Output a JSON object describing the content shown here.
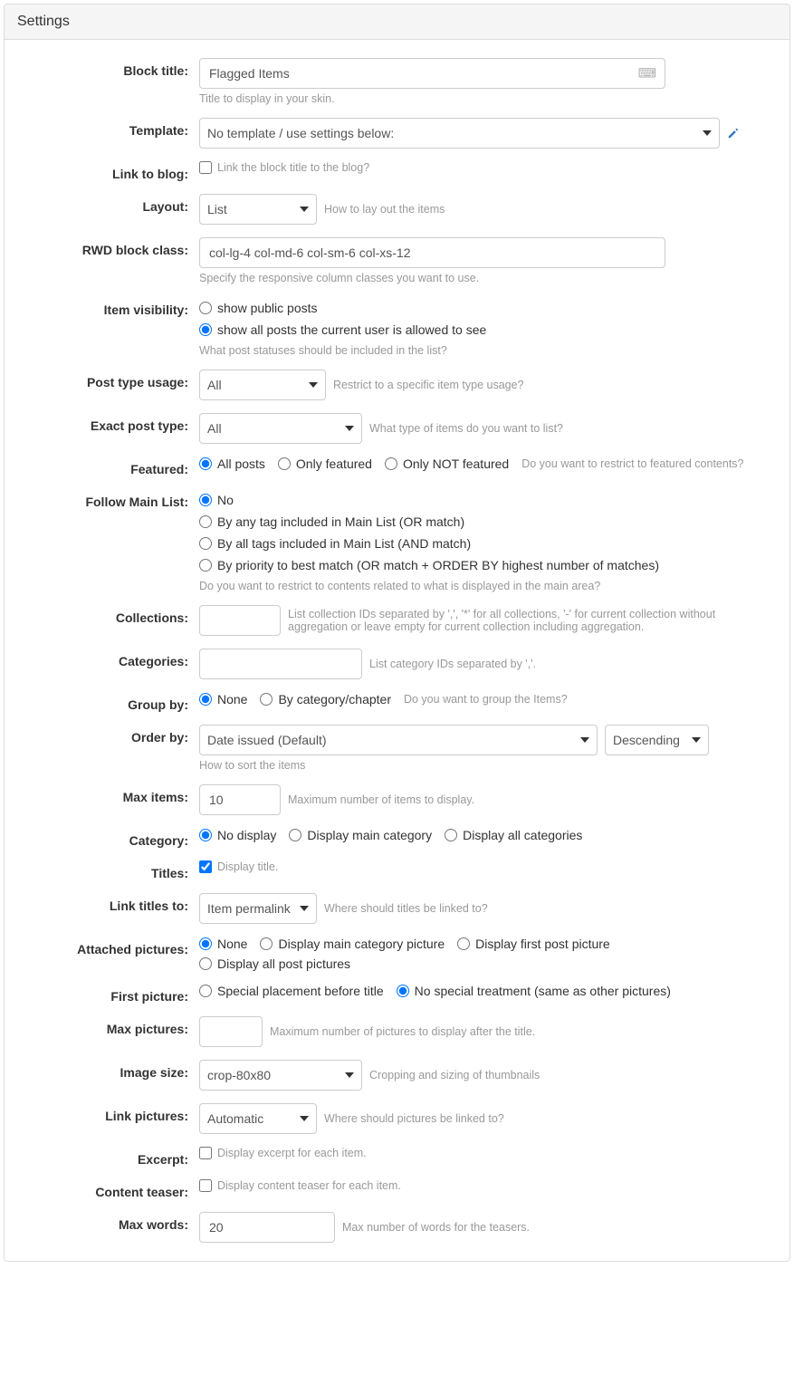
{
  "panel": {
    "title": "Settings"
  },
  "fields": {
    "block_title": {
      "label": "Block title:",
      "value": "Flagged Items",
      "help": "Title to display in your skin."
    },
    "template": {
      "label": "Template:",
      "value": "No template / use settings below:"
    },
    "link_blog": {
      "label": "Link to blog:",
      "checkbox_label": "Link the block title to the blog?"
    },
    "layout": {
      "label": "Layout:",
      "value": "List",
      "help": "How to lay out the items"
    },
    "rwd": {
      "label": "RWD block class:",
      "value": "col-lg-4 col-md-6 col-sm-6 col-xs-12",
      "help": "Specify the responsive column classes you want to use."
    },
    "visibility": {
      "label": "Item visibility:",
      "opt1": "show public posts",
      "opt2": "show all posts the current user is allowed to see",
      "help": "What post statuses should be included in the list?"
    },
    "post_type_usage": {
      "label": "Post type usage:",
      "value": "All",
      "help": "Restrict to a specific item type usage?"
    },
    "exact_post_type": {
      "label": "Exact post type:",
      "value": "All",
      "help": "What type of items do you want to list?"
    },
    "featured": {
      "label": "Featured:",
      "opt1": "All posts",
      "opt2": "Only featured",
      "opt3": "Only NOT featured",
      "help": "Do you want to restrict to featured contents?"
    },
    "follow": {
      "label": "Follow Main List:",
      "opt1": "No",
      "opt2": "By any tag included in Main List (OR match)",
      "opt3": "By all tags included in Main List (AND match)",
      "opt4": "By priority to best match (OR match + ORDER BY highest number of matches)",
      "help": "Do you want to restrict to contents related to what is displayed in the main area?"
    },
    "collections": {
      "label": "Collections:",
      "help": "List collection IDs separated by ',', '*' for all collections, '-' for current collection without aggregation or leave empty for current collection including aggregation."
    },
    "categories": {
      "label": "Categories:",
      "help": "List category IDs separated by ','."
    },
    "group_by": {
      "label": "Group by:",
      "opt1": "None",
      "opt2": "By category/chapter",
      "help": "Do you want to group the Items?"
    },
    "order_by": {
      "label": "Order by:",
      "value": "Date issued (Default)",
      "dir": "Descending",
      "help": "How to sort the items"
    },
    "max_items": {
      "label": "Max items:",
      "value": "10",
      "help": "Maximum number of items to display."
    },
    "category": {
      "label": "Category:",
      "opt1": "No display",
      "opt2": "Display main category",
      "opt3": "Display all categories"
    },
    "titles": {
      "label": "Titles:",
      "checkbox_label": "Display title."
    },
    "link_titles": {
      "label": "Link titles to:",
      "value": "Item permalink",
      "help": "Where should titles be linked to?"
    },
    "attached": {
      "label": "Attached pictures:",
      "opt1": "None",
      "opt2": "Display main category picture",
      "opt3": "Display first post picture",
      "opt4": "Display all post pictures"
    },
    "first_picture": {
      "label": "First picture:",
      "opt1": "Special placement before title",
      "opt2": "No special treatment (same as other pictures)"
    },
    "max_pictures": {
      "label": "Max pictures:",
      "help": "Maximum number of pictures to display after the title."
    },
    "image_size": {
      "label": "Image size:",
      "value": "crop-80x80",
      "help": "Cropping and sizing of thumbnails"
    },
    "link_pictures": {
      "label": "Link pictures:",
      "value": "Automatic",
      "help": "Where should pictures be linked to?"
    },
    "excerpt": {
      "label": "Excerpt:",
      "checkbox_label": "Display excerpt for each item."
    },
    "content_teaser": {
      "label": "Content teaser:",
      "checkbox_label": "Display content teaser for each item."
    },
    "max_words": {
      "label": "Max words:",
      "value": "20",
      "help": "Max number of words for the teasers."
    }
  }
}
